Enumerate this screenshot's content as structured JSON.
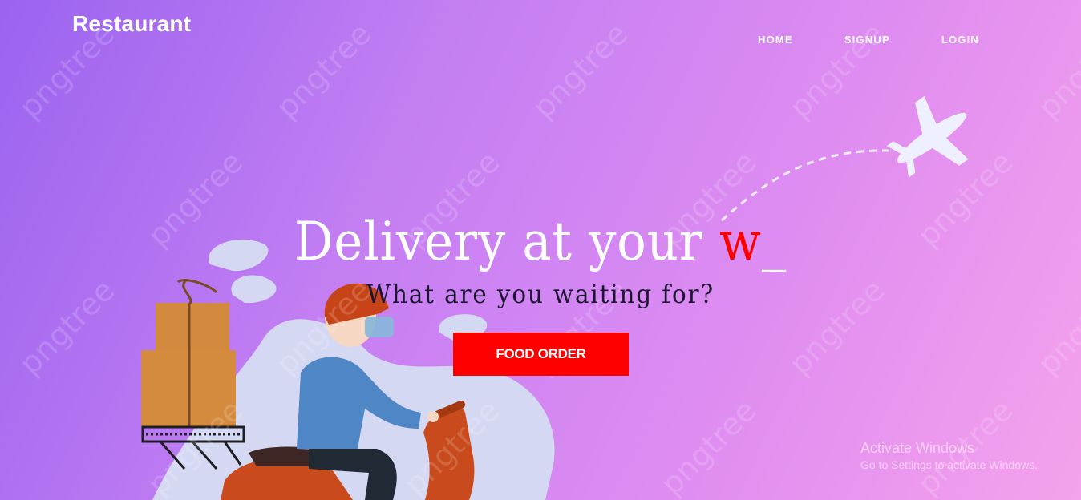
{
  "brand": {
    "name": "Restaurant"
  },
  "nav": {
    "items": [
      "HOME",
      "SIGNUP",
      "LOGIN"
    ]
  },
  "hero": {
    "headline_prefix": "Delivery at your ",
    "typed_text": "w",
    "cursor": "_",
    "subheadline": "What are you waiting for?",
    "cta_label": "FOOD ORDER"
  },
  "watermark": {
    "text": "pngtree"
  },
  "os_overlay": {
    "title": "Activate Windows",
    "subtitle": "Go to Settings to activate Windows."
  },
  "colors": {
    "accent": "#ff0000",
    "gradient_start": "#9a63f0",
    "gradient_end": "#f5a2ec"
  },
  "icons": [
    "airplane-icon",
    "delivery-rider-illustration"
  ]
}
